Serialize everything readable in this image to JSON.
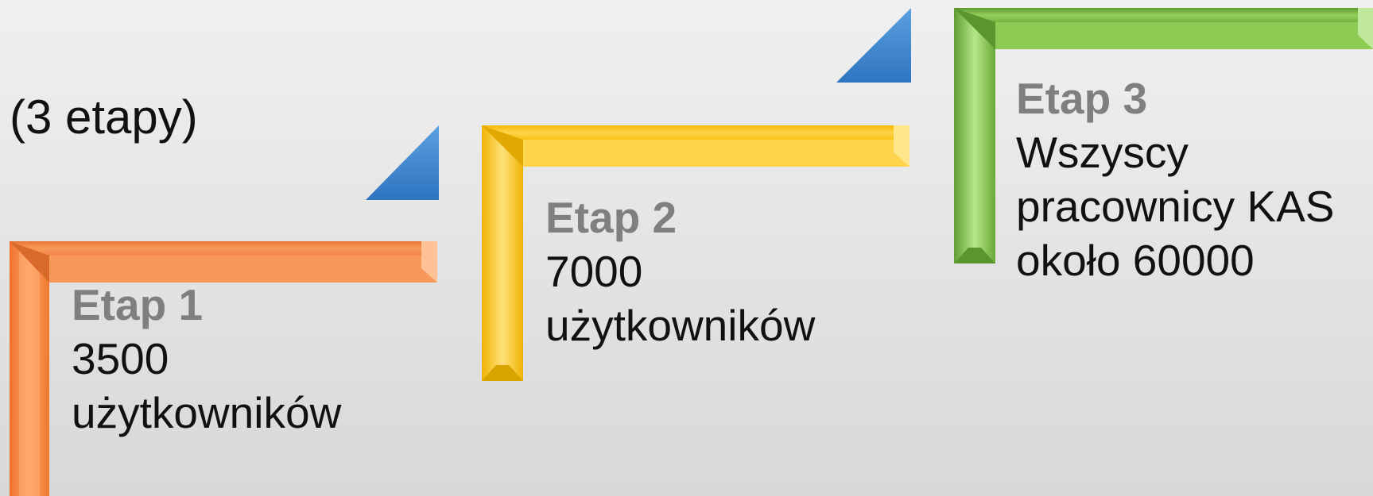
{
  "subtitle": "(3 etapy)",
  "steps": [
    {
      "title": "Etap 1",
      "lines": [
        "3500",
        "użytkowników"
      ],
      "color": "#f28a3c"
    },
    {
      "title": "Etap 2",
      "lines": [
        "7000",
        "użytkowników"
      ],
      "color": "#f7c21d"
    },
    {
      "title": "Etap 3",
      "lines": [
        "Wszyscy",
        "pracownicy KAS",
        "około 60000"
      ],
      "color": "#7ab648"
    }
  ],
  "arrow_color": "#4a8fd6"
}
